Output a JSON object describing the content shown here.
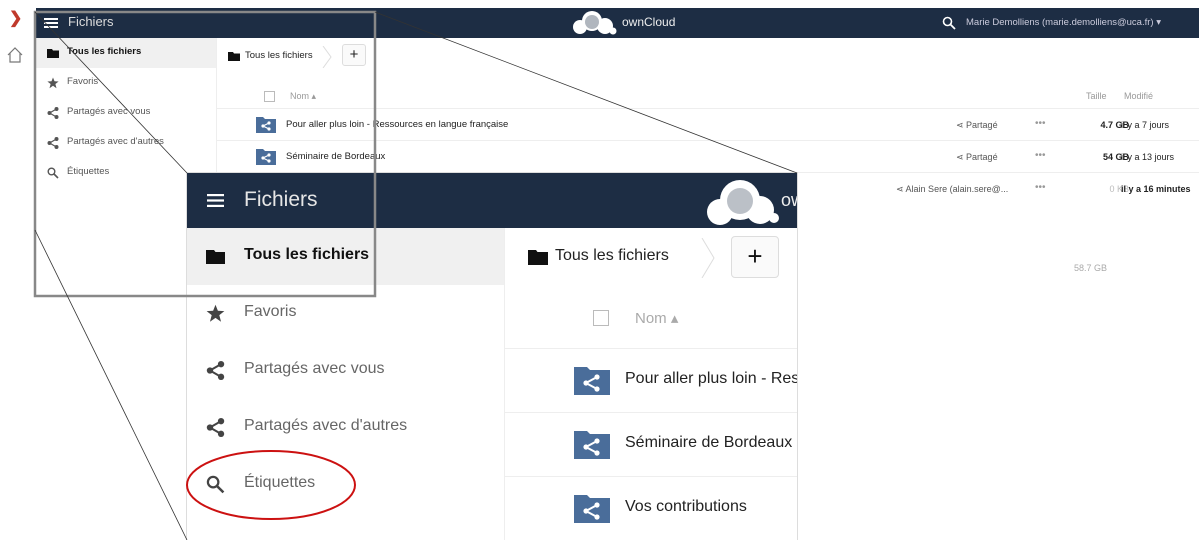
{
  "app": {
    "title": "Fichiers",
    "brand": "ownCloud",
    "user": "Marie Demolliens (marie.demolliens@uca.fr) ▾"
  },
  "sidebar": {
    "items": [
      {
        "label": "Tous les fichiers",
        "icon": "folder-icon",
        "active": true
      },
      {
        "label": "Favoris",
        "icon": "star-icon"
      },
      {
        "label": "Partagés avec vous",
        "icon": "share-icon"
      },
      {
        "label": "Partagés avec d'autres",
        "icon": "share-icon"
      },
      {
        "label": "Étiquettes",
        "icon": "search-icon"
      }
    ]
  },
  "breadcrumb": {
    "label": "Tous les fichiers",
    "add": "+"
  },
  "columns": {
    "name": "Nom ▴",
    "size": "Taille",
    "modified": "Modifié"
  },
  "files": [
    {
      "name": "Pour aller plus loin - Ressources en langue française",
      "share": "Partagé",
      "menu": "•••",
      "size": "4.7 GB",
      "modified": "il y a 7 jours"
    },
    {
      "name": "Séminaire de Bordeaux",
      "share": "Partagé",
      "menu": "•••",
      "size": "54 GB",
      "modified": "il y a 13 jours"
    },
    {
      "name": "Vos contributions",
      "share": "Alain Sere (alain.sere@...",
      "menu": "•••",
      "size": "0 KB",
      "modified": "il y a 16 minutes"
    }
  ],
  "total": "58.7 GB",
  "zoom": {
    "title": "Fichiers",
    "brand": "ow",
    "files": [
      "Pour aller plus loin - Res",
      "Séminaire de Bordeaux",
      "Vos contributions"
    ]
  },
  "colors": {
    "topbar": "#1d2d44",
    "folder": "#4a6d9a",
    "highlight": "#cc1111"
  }
}
